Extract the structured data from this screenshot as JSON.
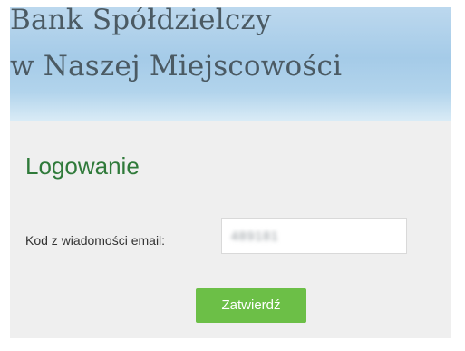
{
  "header": {
    "bank_name_line1": "Bank Spółdzielczy",
    "bank_name_line2": "w Naszej Miejscowości"
  },
  "login": {
    "title": "Logowanie",
    "code_label": "Kod z wiadomości email:",
    "code_value": "489181",
    "submit_label": "Zatwierdź"
  },
  "colors": {
    "title_green": "#2f7a3a",
    "button_green": "#6cbf47",
    "banner_blue": "#a5cbe8",
    "panel_gray": "#efefef"
  }
}
